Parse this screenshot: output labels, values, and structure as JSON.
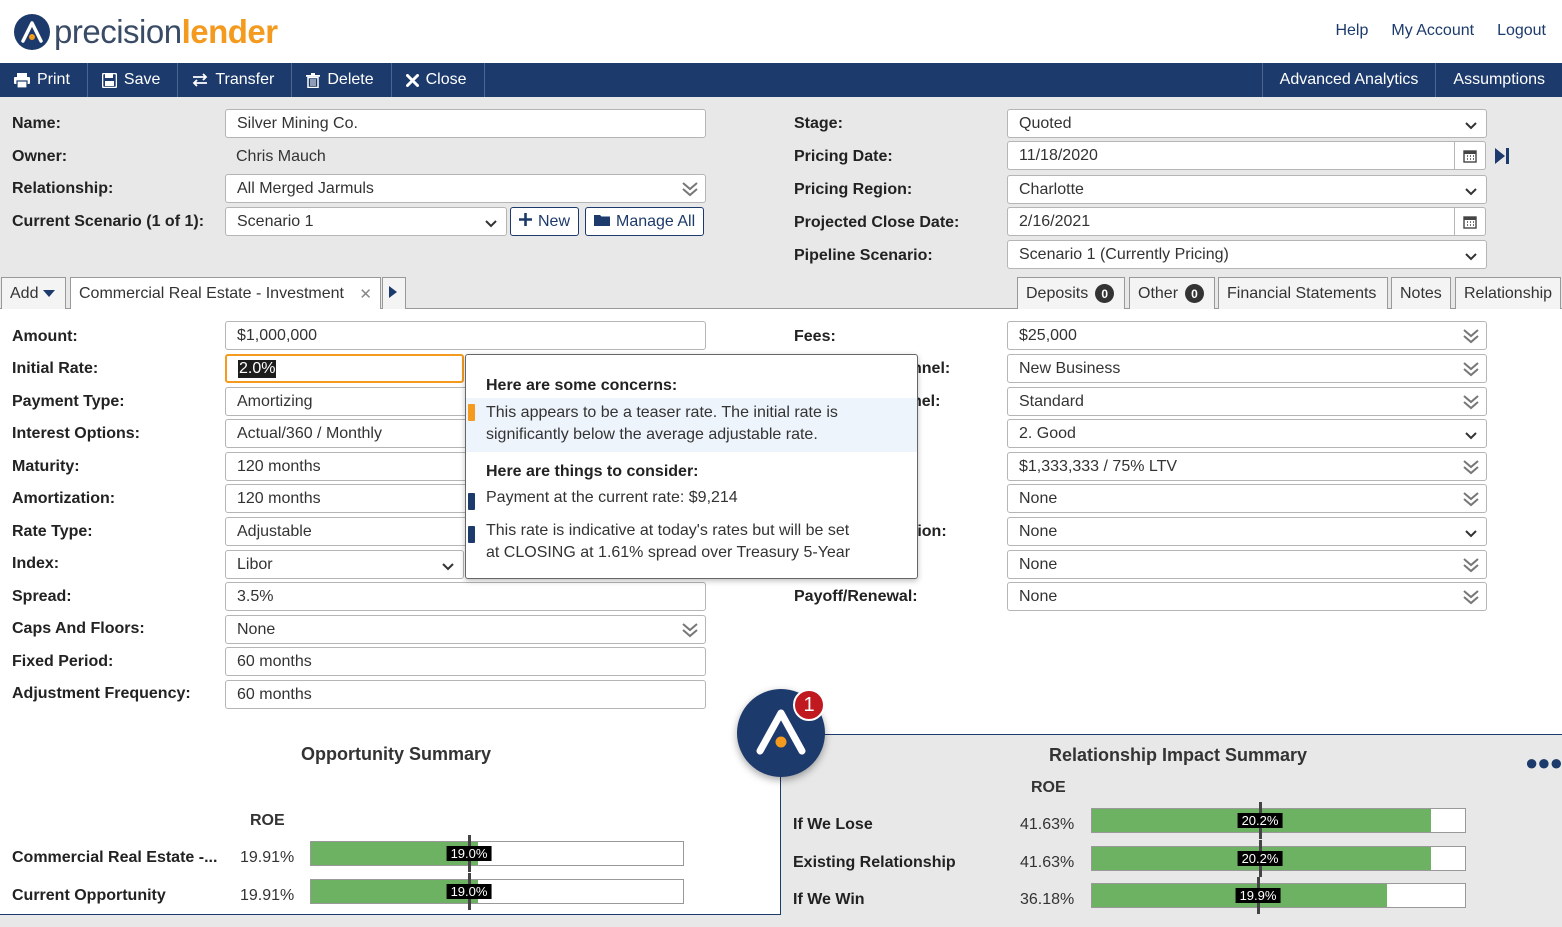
{
  "brand": {
    "part1": "precision",
    "part2": "lender"
  },
  "top_links": [
    "Help",
    "My Account",
    "Logout"
  ],
  "toolbar": {
    "left": [
      {
        "label": "Print",
        "icon": "print-icon"
      },
      {
        "label": "Save",
        "icon": "save-icon"
      },
      {
        "label": "Transfer",
        "icon": "transfer-icon"
      },
      {
        "label": "Delete",
        "icon": "trash-icon"
      },
      {
        "label": "Close",
        "icon": "close-icon"
      }
    ],
    "right": [
      "Advanced Analytics",
      "Assumptions"
    ]
  },
  "top_form": {
    "name_label": "Name:",
    "name_value": "Silver Mining Co.",
    "owner_label": "Owner:",
    "owner_value": "Chris Mauch",
    "relationship_label": "Relationship:",
    "relationship_value": "All Merged Jarmuls",
    "scenario_label": "Current Scenario (1 of 1):",
    "scenario_value": "Scenario 1",
    "new_label": "New",
    "manage_label": "Manage All",
    "stage_label": "Stage:",
    "stage_value": "Quoted",
    "pricing_date_label": "Pricing Date:",
    "pricing_date_value": "11/18/2020",
    "region_label": "Pricing Region:",
    "region_value": "Charlotte",
    "close_date_label": "Projected Close Date:",
    "close_date_value": "2/16/2021",
    "pipeline_label": "Pipeline Scenario:",
    "pipeline_value": "Scenario 1 (Currently Pricing)"
  },
  "tabs": {
    "add_label": "Add",
    "active_tab": "Commercial Real Estate - Investment",
    "right": [
      {
        "label": "Deposits",
        "count": "0"
      },
      {
        "label": "Other",
        "count": "0"
      },
      {
        "label": "Financial Statements"
      },
      {
        "label": "Notes"
      },
      {
        "label": "Relationship"
      }
    ]
  },
  "loan_form": {
    "left": [
      {
        "label": "Amount:",
        "value": "$1,000,000"
      },
      {
        "label": "Initial Rate:",
        "value": "2.0%"
      },
      {
        "label": "Payment Type:",
        "value": "Amortizing"
      },
      {
        "label": "Interest Options:",
        "value": "Actual/360 / Monthly"
      },
      {
        "label": "Maturity:",
        "value": "120 months"
      },
      {
        "label": "Amortization:",
        "value": "120 months"
      },
      {
        "label": "Rate Type:",
        "value": "Adjustable"
      },
      {
        "label": "Index:",
        "value": "Libor"
      },
      {
        "label": "Spread:",
        "value": "3.5%"
      },
      {
        "label": "Caps And Floors:",
        "value": "None"
      },
      {
        "label": "Fixed Period:",
        "value": "60 months"
      },
      {
        "label": "Adjustment Frequency:",
        "value": "60 months"
      }
    ],
    "right": [
      {
        "label": "Fees:",
        "value": "$25,000"
      },
      {
        "label": "nnel:",
        "value": "New Business"
      },
      {
        "label": "nel:",
        "value": "Standard"
      },
      {
        "label": "",
        "value": "2. Good"
      },
      {
        "label": "",
        "value": "$1,333,333 / 75% LTV"
      },
      {
        "label": "",
        "value": "None"
      },
      {
        "label": "tion:",
        "value": "None"
      },
      {
        "label": "",
        "value": "None"
      },
      {
        "label": "Payoff/Renewal:",
        "value": "None"
      }
    ]
  },
  "tooltip": {
    "concerns_title": "Here are some concerns:",
    "concern_line1": "This appears to be a teaser rate. The initial rate is",
    "concern_line2": "significantly below the average adjustable rate.",
    "consider_title": "Here are things to consider:",
    "consider1": "Payment at the current rate: $9,214",
    "consider2_line1": "This rate is indicative at today's rates but will be set",
    "consider2_line2": "at CLOSING at 1.61% spread over Treasury 5-Year",
    "colors": {
      "concern": "#f39a1f",
      "consider": "#1c3a6b"
    }
  },
  "assistant": {
    "badge": "1"
  },
  "opportunity_summary": {
    "title": "Opportunity Summary",
    "col": "ROE",
    "rows": [
      {
        "label": "Commercial Real Estate -...",
        "value": "19.91%",
        "bar_label": "19.0%",
        "fill": 0.45,
        "marker": 0.425
      },
      {
        "label": "Current Opportunity",
        "value": "19.91%",
        "bar_label": "19.0%",
        "fill": 0.45,
        "marker": 0.425
      }
    ]
  },
  "relationship_summary": {
    "title": "Relationship Impact Summary",
    "col": "ROE",
    "rows": [
      {
        "label": "If We Lose",
        "value": "41.63%",
        "bar_label": "20.2%",
        "fill": 0.91,
        "marker": 0.45
      },
      {
        "label": "Existing Relationship",
        "value": "41.63%",
        "bar_label": "20.2%",
        "fill": 0.91,
        "marker": 0.45
      },
      {
        "label": "If We Win",
        "value": "36.18%",
        "bar_label": "19.9%",
        "fill": 0.79,
        "marker": 0.445
      }
    ]
  }
}
